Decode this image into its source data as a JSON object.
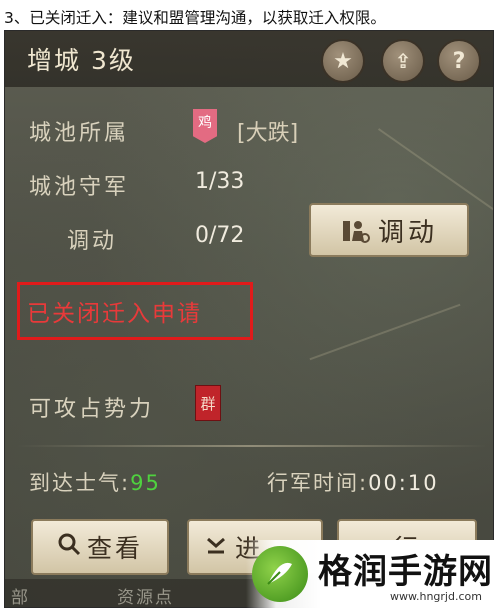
{
  "caption": "3、已关闭迁入：建议和盟管理沟通，以获取迁入权限。",
  "header": {
    "title": "增城  3级",
    "favorite_icon": "★",
    "share_icon": "⇪",
    "help_icon": "?"
  },
  "info": {
    "owner_label": "城池所属",
    "owner_flag": "鸡",
    "owner_name": "[大跌]",
    "garrison_label": "城池守军",
    "garrison_value": "1/33",
    "transfer_label": "调动",
    "transfer_value": "0/72",
    "transfer_button": "调动"
  },
  "status": {
    "closed_text": "已关闭迁入申请"
  },
  "attack": {
    "label": "可攻占势力",
    "flag": "群"
  },
  "march": {
    "morale_label": "到达士气:",
    "morale_value": "95",
    "time_label": "行军时间:",
    "time_value": "00:10"
  },
  "actions": {
    "view_label": "查看",
    "attack_label": "进",
    "march_label": "行"
  },
  "map_bottom": {
    "left_text": "部",
    "center_text": "资源点"
  },
  "watermark": {
    "site_name": "格润手游网",
    "url": "www.hngrjd.com"
  },
  "colors": {
    "alert_red": "#e83a3a",
    "morale_green": "#4fd23f",
    "button_bg": "#ece2cb"
  }
}
